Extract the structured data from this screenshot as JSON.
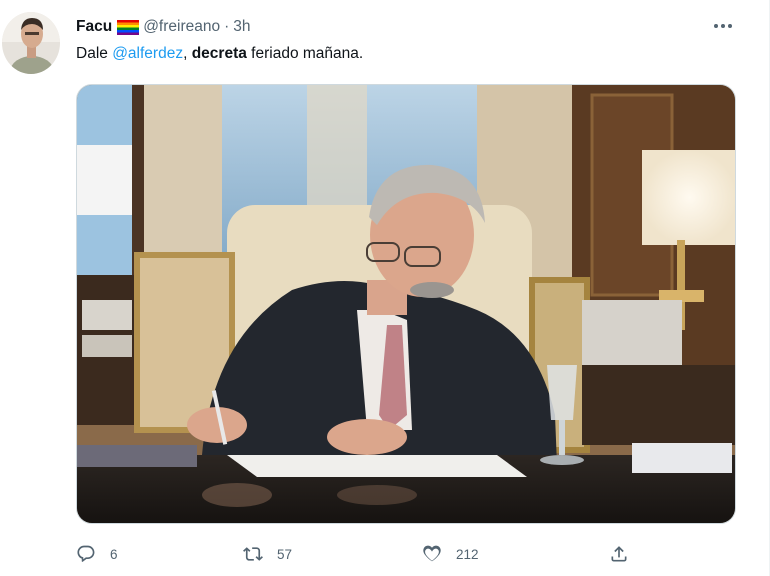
{
  "author": {
    "display_name": "Facu",
    "handle": "@freireano",
    "separator": "·",
    "time": "3h",
    "flag_emoji": "rainbow-flag"
  },
  "tweet": {
    "text_prefix": "Dale ",
    "mention": "@alferdez",
    "text_comma": ", ",
    "text_bold": "decreta",
    "text_suffix": " feriado mañana."
  },
  "actions": {
    "replies": "6",
    "retweets": "57",
    "likes": "212"
  },
  "icons": {
    "more": "more-horizontal-icon",
    "reply": "reply-icon",
    "retweet": "retweet-icon",
    "like": "heart-icon",
    "share": "share-icon"
  },
  "colors": {
    "text": "#0f1419",
    "muted": "#536471",
    "link": "#1d9bf0",
    "border": "#cfd9de"
  }
}
